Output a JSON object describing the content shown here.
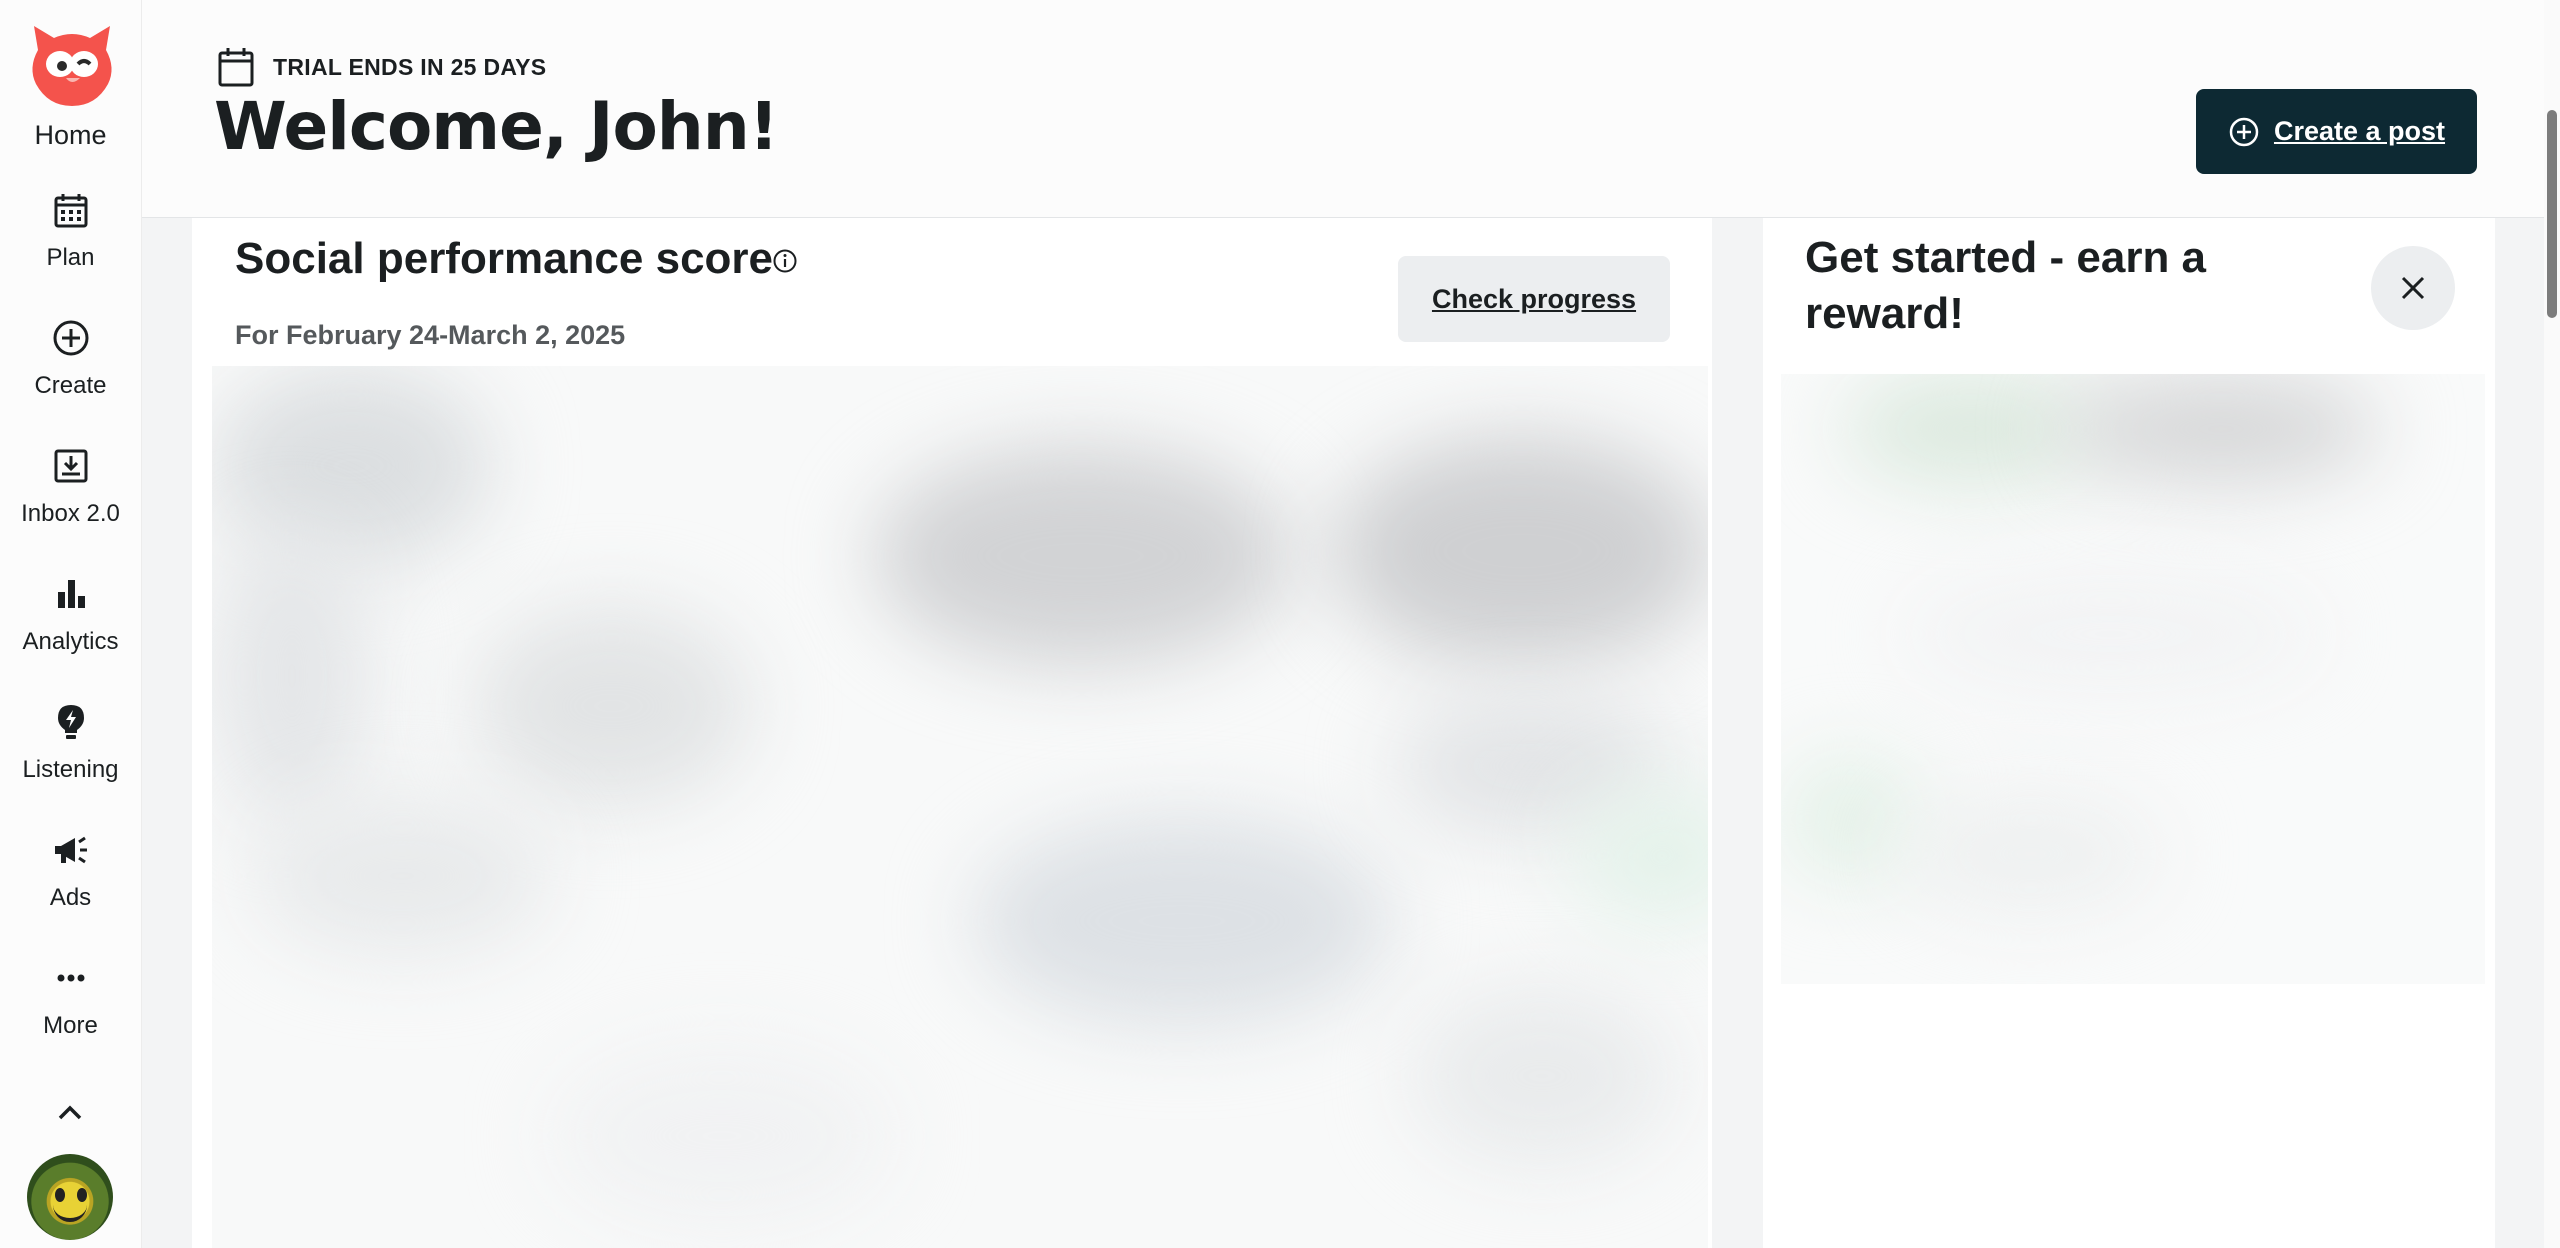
{
  "sidebar": {
    "logo_icon": "hootsuite-owl-icon",
    "home_label": "Home",
    "items": [
      {
        "label": "Plan",
        "icon": "calendar-grid-icon"
      },
      {
        "label": "Create",
        "icon": "plus-circle-icon"
      },
      {
        "label": "Inbox 2.0",
        "icon": "inbox-download-icon"
      },
      {
        "label": "Analytics",
        "icon": "bar-chart-icon"
      },
      {
        "label": "Listening",
        "icon": "lightbulb-bolt-icon"
      },
      {
        "label": "Ads",
        "icon": "megaphone-icon"
      },
      {
        "label": "More",
        "icon": "more-dots-icon"
      }
    ],
    "collapse_icon": "chevron-up-icon",
    "avatar_icon": "user-avatar"
  },
  "header": {
    "trial_text": "TRIAL ENDS IN 25 DAYS",
    "welcome": "Welcome, John!",
    "create_post_label": "Create a post"
  },
  "performance_card": {
    "title": "Social performance score",
    "date_range": "For February 24-March 2, 2025",
    "check_progress_label": "Check progress"
  },
  "reward_card": {
    "title": "Get started - earn a reward!"
  },
  "colors": {
    "brand_red": "#f4534c",
    "primary_button": "#0d2933",
    "secondary_button": "#eceef0",
    "background": "#f3f4f5"
  }
}
